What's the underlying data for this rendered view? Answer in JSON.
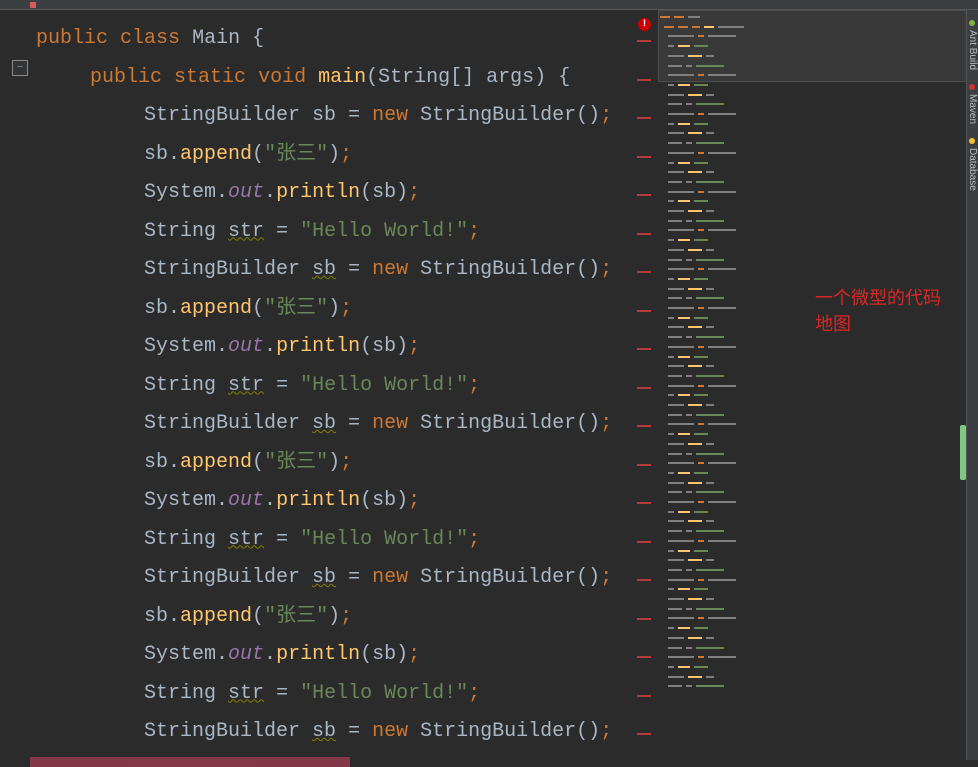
{
  "code": {
    "line1": {
      "kw1": "public",
      "kw2": "class",
      "id": "Main",
      "brace": "{"
    },
    "line2": {
      "kw1": "public",
      "kw2": "static",
      "kw3": "void",
      "id": "main",
      "args_open": "(",
      "type": "String",
      "brackets": "[]",
      "argname": "args",
      "args_close": ")",
      "brace": "{"
    },
    "sb_decl": {
      "type": "StringBuilder",
      "var": "sb",
      "eq": "=",
      "kw": "new",
      "ctor": "StringBuilder",
      "parens": "()",
      "semi": ";"
    },
    "append": {
      "obj": "sb",
      "dot": ".",
      "method": "append",
      "open": "(",
      "str": "\"张三\"",
      "close": ")",
      "semi": ";"
    },
    "println": {
      "cls": "System",
      "dot1": ".",
      "field": "out",
      "dot2": ".",
      "method": "println",
      "open": "(",
      "arg": "sb",
      "close": ")",
      "semi": ";"
    },
    "strdecl": {
      "type": "String",
      "var": "str",
      "eq": "=",
      "str": "\"Hello World!\"",
      "semi": ";"
    }
  },
  "annotation": {
    "l1": "一个微型的代码",
    "l2": "地图"
  },
  "side": {
    "tab1": "Ant Build",
    "tab2": "Maven",
    "tab3": "Database"
  },
  "fold": "−"
}
